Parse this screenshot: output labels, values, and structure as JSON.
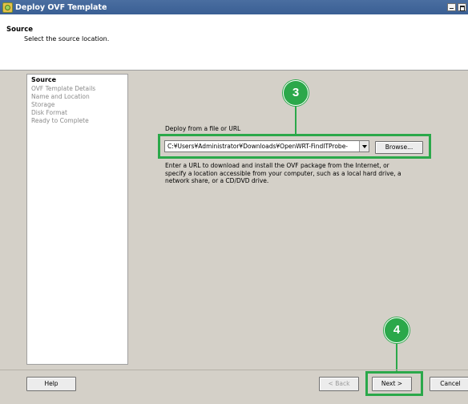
{
  "window": {
    "title": "Deploy OVF Template"
  },
  "header": {
    "title": "Source",
    "subtitle": "Select the source location."
  },
  "steps": [
    {
      "label": "Source",
      "active": true
    },
    {
      "label": "OVF Template Details",
      "active": false
    },
    {
      "label": "Name and Location",
      "active": false
    },
    {
      "label": "Storage",
      "active": false
    },
    {
      "label": "Disk Format",
      "active": false
    },
    {
      "label": "Ready to Complete",
      "active": false
    }
  ],
  "content": {
    "deploy_label": "Deploy from a file or URL",
    "path_value": "C:¥Users¥Administrator¥Downloads¥OpenWRT-FindITProbe-",
    "browse_label": "Browse...",
    "description_lines": [
      "Enter a URL to download and install the OVF package from the Internet, or",
      "specify a location accessible from your computer, such as a local hard drive, a",
      "network share, or a CD/DVD drive."
    ]
  },
  "annotations": {
    "badge_3": "3",
    "badge_4": "4",
    "accent_color": "#2ba84a"
  },
  "footer": {
    "help_label": "Help",
    "back_label": "< Back",
    "next_label": "Next >",
    "cancel_label": "Cancel"
  }
}
